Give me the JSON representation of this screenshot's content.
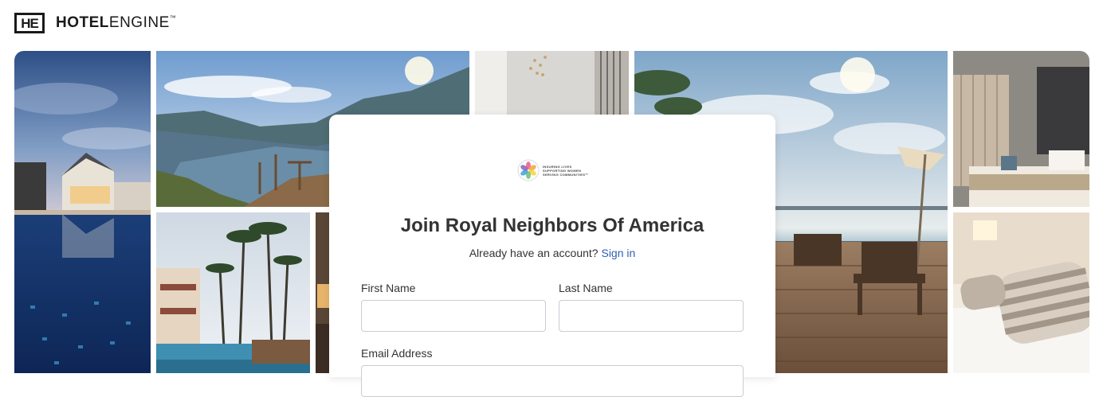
{
  "header": {
    "logo_mark": "HE",
    "logo_word_bold": "HOTEL",
    "logo_word_light": "ENGINE",
    "logo_tm": "™"
  },
  "brand": {
    "line1": "INSURING LIVES",
    "line2": "SUPPORTING WOMEN",
    "line3": "SERVING COMMUNITIES™"
  },
  "form": {
    "title": "Join Royal Neighbors Of America",
    "account_prompt": "Already have an account?",
    "signin_link": "Sign in",
    "first_name_label": "First Name",
    "first_name_value": "",
    "last_name_label": "Last Name",
    "last_name_value": "",
    "email_label": "Email Address",
    "email_value": ""
  },
  "colors": {
    "link": "#2f5fb3",
    "title": "#333333",
    "input_border": "#c9cdd4"
  }
}
